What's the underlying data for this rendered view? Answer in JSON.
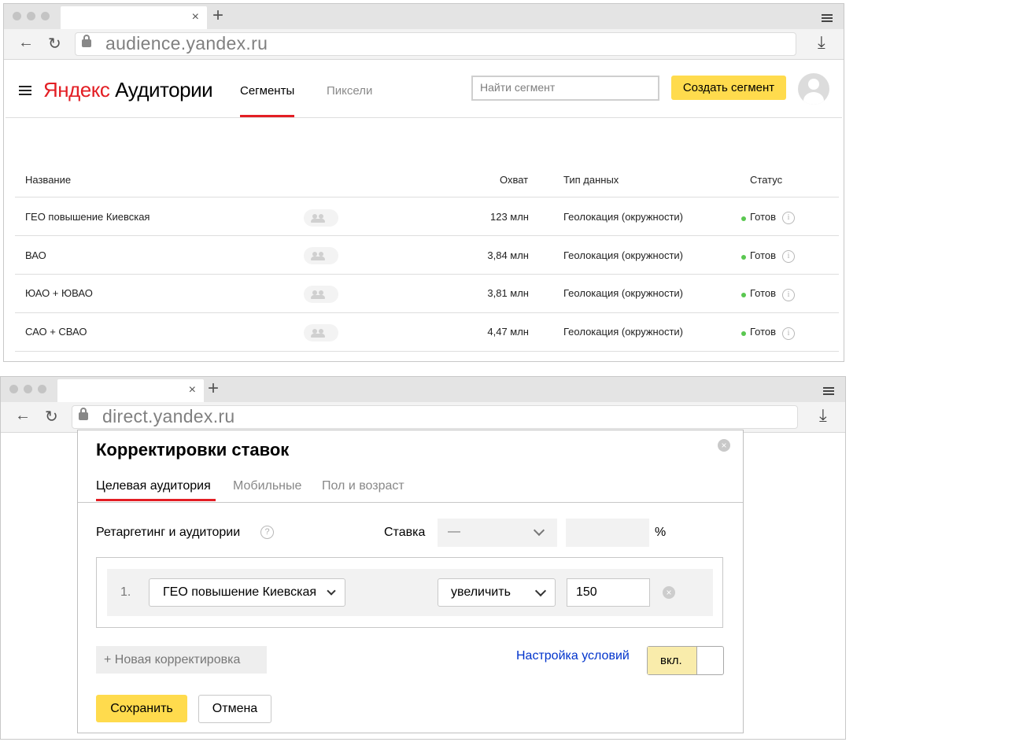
{
  "top_browser": {
    "url": "audience.yandex.ru",
    "tab_close": "×",
    "new_tab": "+"
  },
  "audience": {
    "logo_part1": "Яндекс",
    "logo_part2": "Аудитории",
    "nav": {
      "segments": "Сегменты",
      "pixels": "Пиксели"
    },
    "search_placeholder": "Найти сегмент",
    "create_button": "Создать сегмент",
    "table": {
      "headers": {
        "name": "Название",
        "reach": "Охват",
        "type": "Тип данных",
        "status": "Статус"
      },
      "rows": [
        {
          "name": "ГЕО повышение Киевская",
          "reach": "123 млн",
          "type": "Геолокация (окружности)",
          "status": "Готов"
        },
        {
          "name": "ВАО",
          "reach": "3,84 млн",
          "type": "Геолокация (окружности)",
          "status": "Готов"
        },
        {
          "name": "ЮАО + ЮВАО",
          "reach": "3,81 млн",
          "type": "Геолокация (окружности)",
          "status": "Готов"
        },
        {
          "name": "САО + СВАО",
          "reach": "4,47 млн",
          "type": "Геолокация (окружности)",
          "status": "Готов"
        }
      ]
    }
  },
  "bottom_browser": {
    "url": "direct.yandex.ru",
    "tab_close": "×",
    "new_tab": "+"
  },
  "direct": {
    "modal_title": "Корректировки ставок",
    "close": "×",
    "tabs": [
      "Целевая аудитория",
      "Мобильные",
      "Пол и возраст"
    ],
    "section_label": "Ретаргетинг и аудитории",
    "help": "?",
    "rate_label": "Ставка",
    "rate_select": "—",
    "rate_input": "",
    "percent": "%",
    "row": {
      "index": "1.",
      "segment": "ГЕО повышение Киевская",
      "action": "увеличить",
      "value": "150",
      "remove": "×"
    },
    "add_button": "+ Новая корректировка",
    "conditions_link": "Настройка условий",
    "toggle_label": "вкл.",
    "save_button": "Сохранить",
    "cancel_button": "Отмена"
  },
  "colors": {
    "accent_yellow": "#ffdb4d",
    "active_red": "#e31e24",
    "link_blue": "#0033cc",
    "status_green": "#5ac750"
  }
}
